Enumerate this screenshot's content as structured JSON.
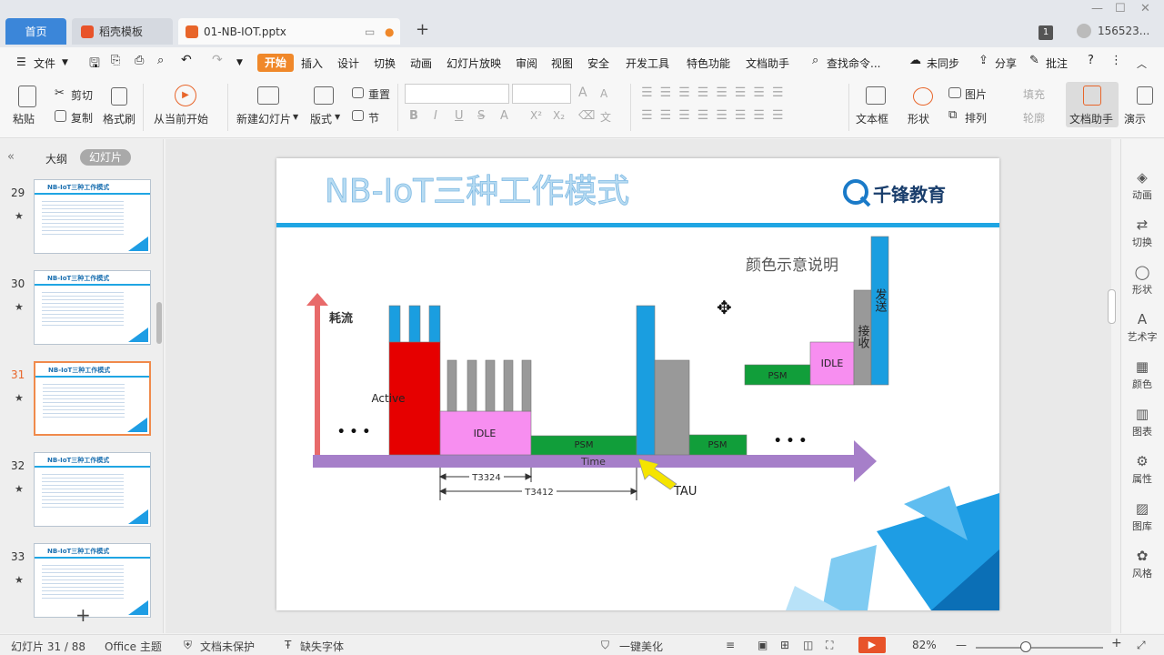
{
  "tabs": {
    "home": "首页",
    "template": "稻壳模板",
    "document": "01-NB-IOT.pptx",
    "user": "156523..."
  },
  "menu": {
    "file": "文件",
    "items": [
      "开始",
      "插入",
      "设计",
      "切换",
      "动画",
      "幻灯片放映",
      "审阅",
      "视图",
      "安全",
      "开发工具",
      "特色功能",
      "文档助手"
    ],
    "search": "查找命令...",
    "sync": "未同步",
    "share": "分享",
    "comment": "批注"
  },
  "ribbon": {
    "paste": "粘贴",
    "cut": "剪切",
    "copy": "复制",
    "format_painter": "格式刷",
    "play_current": "从当前开始",
    "new_slide": "新建幻灯片",
    "layout": "版式",
    "reset": "重置",
    "section": "节",
    "textbox": "文本框",
    "shape": "形状",
    "picture": "图片",
    "arrange": "排列",
    "fill": "填充",
    "outline": "轮廓",
    "doc_assistant": "文档助手",
    "present": "演示"
  },
  "left_panel": {
    "outline_tab": "大纲",
    "slides_tab": "幻灯片",
    "slides": [
      {
        "number": "29",
        "title": "NB-IoT三种工作模式"
      },
      {
        "number": "30",
        "title": "NB-IoT三种工作模式"
      },
      {
        "number": "31",
        "title": "NB-IoT三种工作模式",
        "selected": true
      },
      {
        "number": "32",
        "title": "NB-IoT三种工作模式"
      },
      {
        "number": "33",
        "title": "NB-IoT三种工作模式"
      }
    ]
  },
  "slide": {
    "title": "NB-IoT三种工作模式",
    "logo_text": "千锋教育",
    "y_label": "耗流",
    "time_label": "Time",
    "active_label": "Active",
    "idle_label": "IDLE",
    "psm_label": "PSM",
    "psm2_label": "PSM",
    "tau_label": "TAU",
    "t3324": "T3324",
    "t3412": "T3412",
    "ellipsis": "• • •",
    "legend_title": "颜色示意说明",
    "legend_psm": "PSM",
    "legend_idle": "IDLE",
    "legend_recv": "接收",
    "legend_send": "发送"
  },
  "right_panel": [
    "动画",
    "切换",
    "形状",
    "艺术字",
    "颜色",
    "图表",
    "属性",
    "图库",
    "风格"
  ],
  "status": {
    "slide_info": "幻灯片 31 / 88",
    "theme": "Office 主题",
    "protect": "文档未保护",
    "font_missing": "缺失字体",
    "beautify": "一键美化",
    "zoom": "82%"
  },
  "colors": {
    "active": "#e60000",
    "send": "#1a9ee0",
    "receive": "#999999",
    "idle": "#f78ef0",
    "psm": "#119e3a",
    "time_axis": "#a67fc9",
    "accent": "#f0882a"
  }
}
